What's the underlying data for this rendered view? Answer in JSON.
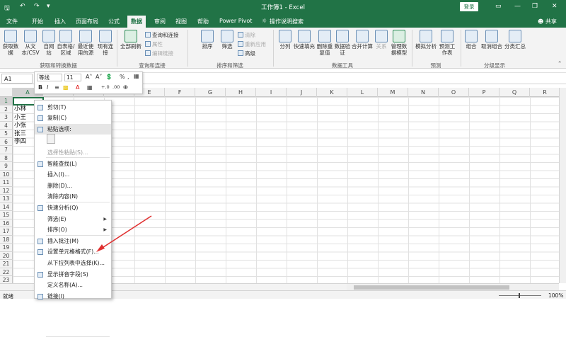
{
  "titlebar": {
    "title": "工作簿1 - Excel",
    "login": "登录",
    "qat": [
      "save-icon",
      "undo-icon",
      "redo-icon"
    ],
    "window_buttons": [
      "▭",
      "—",
      "❐",
      "✕"
    ]
  },
  "tabs": [
    "文件",
    "开始",
    "插入",
    "页面布局",
    "公式",
    "数据",
    "审阅",
    "视图",
    "帮助",
    "Power Pivot",
    "操作说明搜索"
  ],
  "active_tab": "数据",
  "share": "共享",
  "ribbon": {
    "g1": {
      "label": "获取和转换数据",
      "buttons": [
        "获取数据",
        "从文本/CSV",
        "自网站",
        "自表格/区域",
        "最近使用的源",
        "现有连接"
      ]
    },
    "g2": {
      "label": "查询和连接",
      "buttons": [
        "全部刷新"
      ],
      "small": [
        "查询和连接",
        "属性",
        "编辑链接"
      ]
    },
    "g3": {
      "label": "排序和筛选",
      "buttons": [
        "排序",
        "筛选"
      ],
      "small": [
        "清除",
        "重新应用",
        "高级"
      ]
    },
    "g4": {
      "label": "数据工具",
      "buttons": [
        "分列",
        "快速填充",
        "删除重复值",
        "数据验证",
        "合并计算",
        "关系",
        "管理数据模型"
      ]
    },
    "g5": {
      "label": "预测",
      "buttons": [
        "模拟分析",
        "预测工作表"
      ]
    },
    "g6": {
      "label": "分级显示",
      "buttons": [
        "组合",
        "取消组合",
        "分类汇总"
      ]
    }
  },
  "namebox": "A1",
  "minitoolbar": {
    "font": "等线",
    "size": "11",
    "percent": "%"
  },
  "columns": [
    "A",
    "B",
    "C",
    "D",
    "E",
    "F",
    "G",
    "H",
    "I",
    "J",
    "K",
    "L",
    "M",
    "N",
    "O",
    "P",
    "Q",
    "R"
  ],
  "rows": [
    "1",
    "2",
    "3",
    "4",
    "5",
    "6",
    "7",
    "8",
    "9",
    "10",
    "11",
    "12",
    "13",
    "14",
    "15",
    "16",
    "17",
    "18",
    "19",
    "20",
    "21",
    "22",
    "23"
  ],
  "cells": [
    "小林",
    "小王",
    "小张",
    "张三",
    "李四"
  ],
  "context_menu": [
    {
      "label": "剪切(T)",
      "icon": "cut-icon"
    },
    {
      "label": "复制(C)",
      "icon": "copy-icon"
    },
    {
      "label": "粘贴选项:",
      "icon": "paste-icon",
      "hl": true
    },
    {
      "label": "",
      "icon": ""
    },
    {
      "label": "选择性粘贴(S)...",
      "dim": true
    },
    {
      "label": "智能查找(L)",
      "icon": "search-icon"
    },
    {
      "label": "插入(I)..."
    },
    {
      "label": "删除(D)..."
    },
    {
      "label": "清除内容(N)"
    },
    {
      "label": "快速分析(Q)",
      "icon": "quick-analysis-icon"
    },
    {
      "label": "筛选(E)",
      "arrow": true
    },
    {
      "label": "排序(O)",
      "arrow": true
    },
    {
      "label": "插入批注(M)",
      "icon": "comment-icon"
    },
    {
      "label": "设置单元格格式(F)...",
      "icon": "format-cells-icon"
    },
    {
      "label": "从下拉列表中选择(K)..."
    },
    {
      "label": "显示拼音字段(S)",
      "icon": "phonetic-icon"
    },
    {
      "label": "定义名称(A)..."
    },
    {
      "label": "链接(I)",
      "icon": "link-icon"
    }
  ],
  "statusbar": {
    "ready": "就绪",
    "zoom": "100%"
  },
  "colors": {
    "accent": "#217346",
    "arrow": "#e03030"
  }
}
